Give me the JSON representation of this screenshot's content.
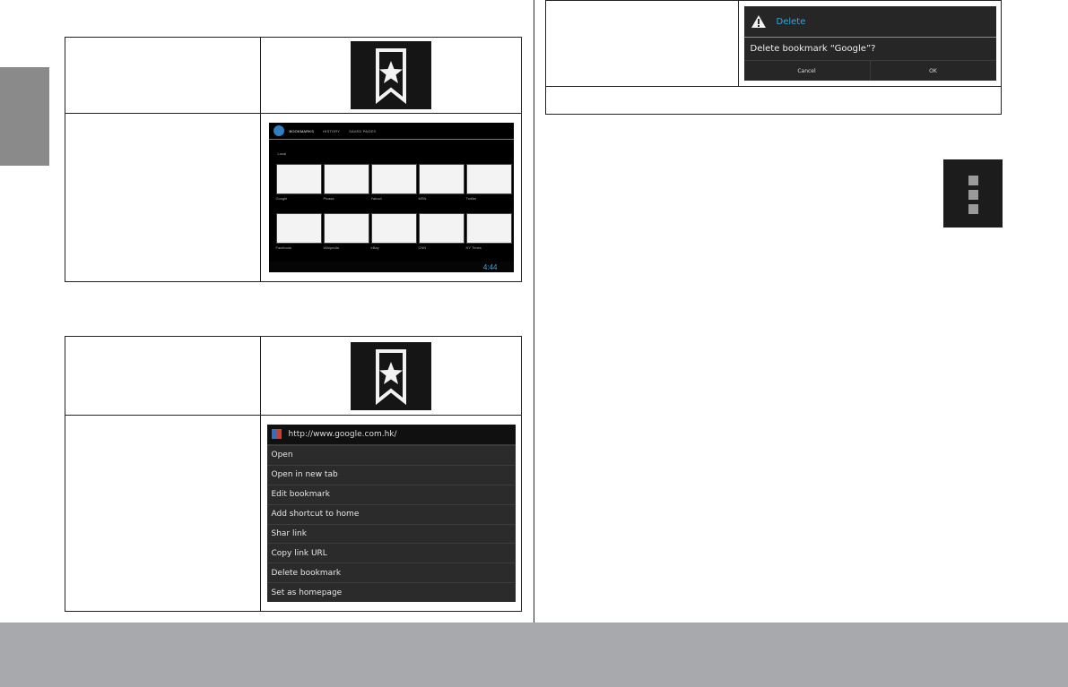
{
  "bookmarks_screen": {
    "tabs": [
      "BOOKMARKS",
      "HISTORY",
      "SAVED PAGES"
    ],
    "folder": "Local",
    "thumbnails": [
      "Google",
      "Picasa",
      "Yahoo!",
      "MSN",
      "Twitter",
      "Facebook",
      "Wikipedia",
      "eBay",
      "CNN",
      "NY Times"
    ],
    "clock": "4:44"
  },
  "context_menu": {
    "url": "http://www.google.com.hk/",
    "items": [
      "Open",
      "Open in new tab",
      "Edit bookmark",
      "Add shortcut to home",
      "Shar link",
      "Copy link URL",
      "Delete bookmark",
      "Set as homepage"
    ]
  },
  "delete_dialog": {
    "title": "Delete",
    "message": "Delete bookmark “Google”?",
    "cancel_label": "Cancel",
    "ok_label": "OK"
  },
  "icons": {
    "bookmark": "bookmark-star-icon",
    "overflow": "overflow-menu-icon",
    "warning": "warning-icon"
  },
  "colors": {
    "accent": "#33a7e0",
    "footer": "#a7a9ac",
    "side_tab": "#8a8a8a"
  }
}
